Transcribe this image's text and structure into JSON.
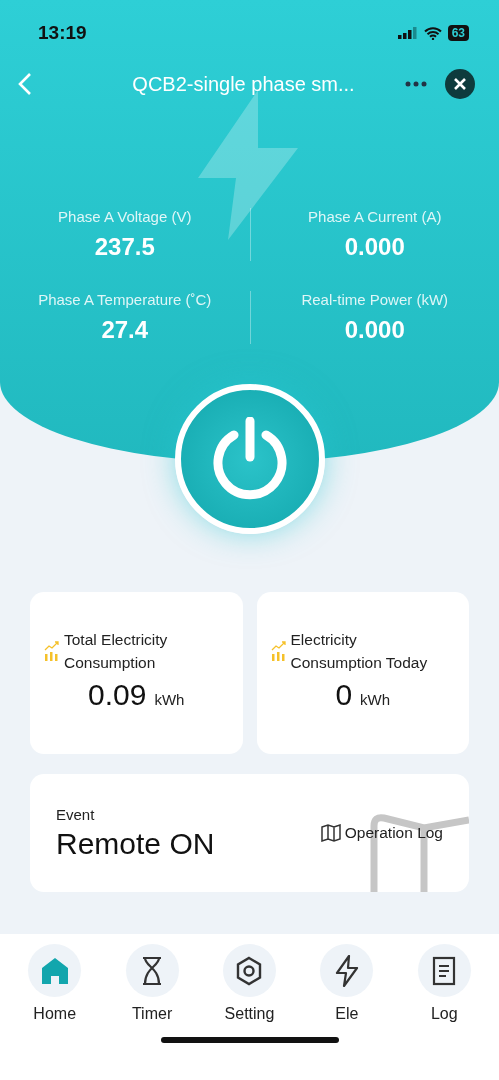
{
  "status_bar": {
    "time": "13:19",
    "battery": "63"
  },
  "header": {
    "title": "QCB2-single phase sm..."
  },
  "readings": [
    {
      "label": "Phase A Voltage (V)",
      "value": "237.5"
    },
    {
      "label": "Phase A Current (A)",
      "value": "0.000"
    },
    {
      "label": "Phase A Temperature (˚C)",
      "value": "27.4"
    },
    {
      "label": "Real-time Power (kW)",
      "value": "0.000"
    }
  ],
  "consumption": [
    {
      "label": "Total Electricity Consumption",
      "value": "0.09",
      "unit": "kWh"
    },
    {
      "label": "Electricity Consumption Today",
      "value": "0",
      "unit": "kWh"
    }
  ],
  "event": {
    "label": "Event",
    "value": "Remote ON",
    "link": "Operation Log"
  },
  "nav": [
    {
      "kind": "home",
      "label": "Home",
      "selected": true
    },
    {
      "kind": "timer",
      "label": "Timer",
      "selected": false
    },
    {
      "kind": "setting",
      "label": "Setting",
      "selected": false
    },
    {
      "kind": "ele",
      "label": "Ele",
      "selected": false
    },
    {
      "kind": "log",
      "label": "Log",
      "selected": false
    }
  ]
}
